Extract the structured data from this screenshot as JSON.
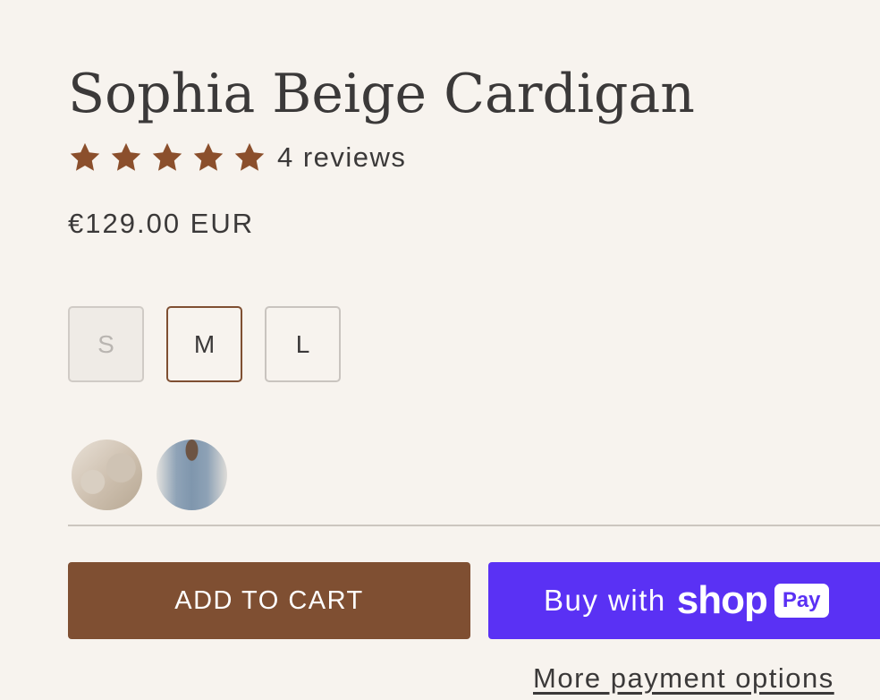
{
  "product": {
    "title": "Sophia Beige Cardigan",
    "rating": {
      "stars": 5,
      "max_stars": 5,
      "star_icon": "star-icon",
      "star_color": "#8b4f2c",
      "reviews_text": "4 reviews"
    },
    "price": "€129.00 EUR"
  },
  "sizes": [
    {
      "label": "S",
      "state": "unavailable"
    },
    {
      "label": "M",
      "state": "selected"
    },
    {
      "label": "L",
      "state": "available"
    }
  ],
  "color_swatches": [
    {
      "name": "beige-swatch"
    },
    {
      "name": "blue-swatch"
    }
  ],
  "actions": {
    "add_to_cart_label": "ADD TO CART",
    "add_to_cart_color": "#7f4f32",
    "buy_with_label": "Buy with",
    "shop_label": "shop",
    "pay_label": "Pay",
    "shop_pay_color": "#5a31f4",
    "more_payment_options": "More payment options"
  }
}
